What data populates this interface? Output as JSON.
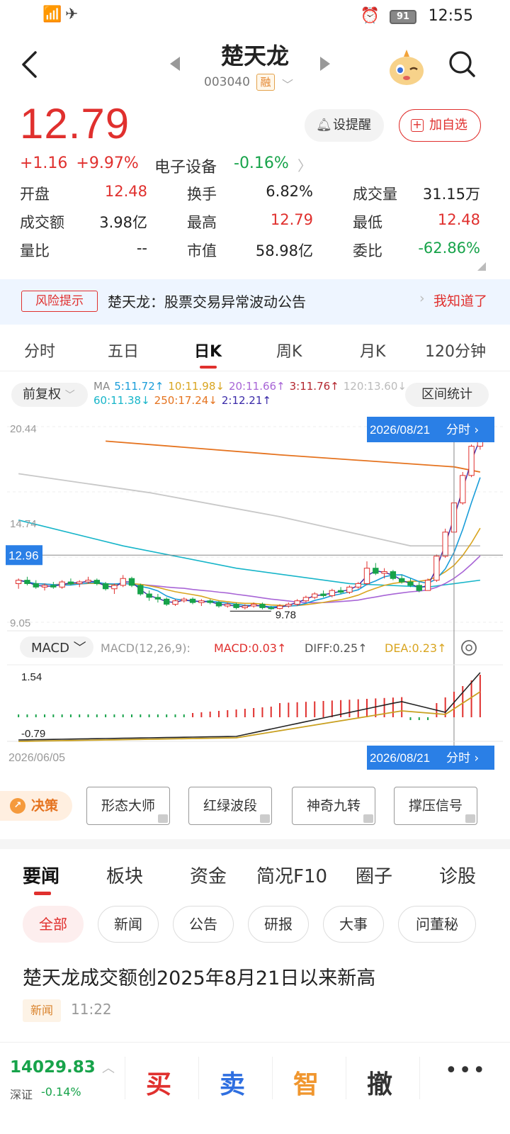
{
  "status_bar": {
    "time": "12:55",
    "battery": "91"
  },
  "header": {
    "title": "楚天龙",
    "code": "003040",
    "margin_tag": "融"
  },
  "quote": {
    "price": "12.79",
    "change": "+1.16",
    "change_pct": "+9.97%",
    "sector_name": "电子设备",
    "sector_change": "-0.16%",
    "alert_label": "设提醒",
    "watch_label": "加自选",
    "stats": [
      {
        "label": "开盘",
        "value": "12.48",
        "color": "#e0302e"
      },
      {
        "label": "换手",
        "value": "6.82%",
        "color": "#222222"
      },
      {
        "label": "成交量",
        "value": "31.15万",
        "color": "#222222"
      },
      {
        "label": "成交额",
        "value": "3.98亿",
        "color": "#222222"
      },
      {
        "label": "最高",
        "value": "12.79",
        "color": "#e0302e"
      },
      {
        "label": "最低",
        "value": "12.48",
        "color": "#e0302e"
      },
      {
        "label": "量比",
        "value": "--",
        "color": "#222222"
      },
      {
        "label": "市值",
        "value": "58.98亿",
        "color": "#222222"
      },
      {
        "label": "委比",
        "value": "-62.86%",
        "color": "#17a34a"
      }
    ]
  },
  "risk": {
    "badge": "风险提示",
    "text": "楚天龙：股票交易异常波动公告",
    "dismiss": "我知道了"
  },
  "period_tabs": [
    "分时",
    "五日",
    "日K",
    "周K",
    "月K",
    "120分钟"
  ],
  "active_period": "日K",
  "ma_bar": {
    "adjust_label": "前复权",
    "range_label": "区间统计",
    "line1": [
      {
        "text": "MA",
        "color": "#888888"
      },
      {
        "text": "5:11.72↑",
        "color": "#1a9dd9"
      },
      {
        "text": "10:11.98↓",
        "color": "#d9a520"
      },
      {
        "text": "20:11.66↑",
        "color": "#a865d6"
      },
      {
        "text": "3:11.76↑",
        "color": "#b3262e"
      },
      {
        "text": "120:13.60↓",
        "color": "#bbbbbb"
      }
    ],
    "line2": [
      {
        "text": "60:11.38↓",
        "color": "#17b5c9"
      },
      {
        "text": "250:17.24↓",
        "color": "#e5731f"
      },
      {
        "text": "2:12.21↑",
        "color": "#3a2aa8"
      }
    ]
  },
  "chart_data": {
    "type": "candlestick",
    "y_labels": [
      "20.44",
      "14.74",
      "9.05"
    ],
    "ylim": [
      9.05,
      20.44
    ],
    "cursor_price": "12.96",
    "low_marker": "9.78",
    "date_start": "2026/06/05",
    "date_cursor": "2026/08/21",
    "cursor_link": "分时",
    "candles": [
      [
        11.3,
        11.6,
        11.0,
        11.5
      ],
      [
        11.5,
        11.7,
        11.2,
        11.3
      ],
      [
        11.3,
        11.5,
        11.0,
        11.1
      ],
      [
        11.1,
        11.3,
        10.9,
        11.2
      ],
      [
        11.2,
        11.4,
        11.0,
        11.1
      ],
      [
        11.1,
        11.5,
        11.0,
        11.4
      ],
      [
        11.4,
        11.6,
        11.2,
        11.3
      ],
      [
        11.3,
        11.5,
        11.1,
        11.4
      ],
      [
        11.4,
        11.7,
        11.3,
        11.5
      ],
      [
        11.5,
        11.6,
        11.2,
        11.3
      ],
      [
        11.3,
        11.4,
        10.9,
        11.0
      ],
      [
        11.0,
        11.3,
        10.7,
        11.2
      ],
      [
        11.2,
        11.8,
        11.1,
        11.6
      ],
      [
        11.6,
        11.7,
        11.1,
        11.2
      ],
      [
        11.2,
        11.3,
        10.6,
        10.7
      ],
      [
        10.7,
        10.9,
        10.3,
        10.5
      ],
      [
        10.5,
        10.7,
        10.2,
        10.4
      ],
      [
        10.4,
        10.5,
        10.0,
        10.1
      ],
      [
        10.1,
        10.4,
        10.0,
        10.3
      ],
      [
        10.3,
        10.5,
        10.2,
        10.4
      ],
      [
        10.4,
        10.5,
        10.1,
        10.2
      ],
      [
        10.2,
        10.4,
        10.0,
        10.3
      ],
      [
        10.3,
        10.4,
        10.1,
        10.2
      ],
      [
        10.2,
        10.3,
        9.9,
        10.0
      ],
      [
        10.0,
        10.2,
        9.9,
        10.1
      ],
      [
        10.1,
        10.2,
        9.8,
        9.9
      ],
      [
        9.9,
        10.1,
        9.8,
        10.0
      ],
      [
        10.0,
        10.2,
        9.9,
        10.1
      ],
      [
        10.1,
        10.2,
        9.8,
        9.9
      ],
      [
        9.9,
        10.0,
        9.78,
        9.85
      ],
      [
        9.85,
        10.1,
        9.8,
        10.0
      ],
      [
        10.0,
        10.2,
        9.9,
        10.1
      ],
      [
        10.1,
        10.4,
        10.0,
        10.3
      ],
      [
        10.3,
        10.6,
        10.2,
        10.5
      ],
      [
        10.5,
        10.8,
        10.4,
        10.7
      ],
      [
        10.7,
        10.9,
        10.5,
        10.6
      ],
      [
        10.6,
        11.0,
        10.5,
        10.9
      ],
      [
        10.9,
        11.1,
        10.7,
        10.8
      ],
      [
        10.8,
        11.2,
        10.7,
        11.1
      ],
      [
        11.1,
        11.4,
        11.0,
        11.3
      ],
      [
        11.3,
        12.6,
        11.2,
        12.2
      ],
      [
        12.2,
        12.5,
        11.8,
        11.9
      ],
      [
        11.9,
        12.2,
        11.6,
        12.0
      ],
      [
        12.0,
        12.1,
        11.5,
        11.6
      ],
      [
        11.6,
        11.8,
        11.3,
        11.4
      ],
      [
        11.4,
        11.6,
        11.1,
        11.2
      ],
      [
        11.2,
        11.4,
        10.8,
        10.9
      ],
      [
        10.9,
        11.6,
        10.9,
        11.5
      ],
      [
        11.5,
        13.0,
        11.4,
        12.9
      ],
      [
        12.9,
        14.5,
        12.8,
        14.3
      ],
      [
        14.3,
        16.2,
        14.2,
        16.0
      ],
      [
        16.0,
        17.8,
        15.9,
        17.6
      ],
      [
        17.6,
        19.4,
        17.5,
        19.3
      ],
      [
        19.3,
        20.44,
        19.1,
        20.2
      ]
    ],
    "macd_label": "MACD",
    "macd_params": "MACD(12,26,9):",
    "macd_value": "MACD:0.03↑",
    "diff_value": "DIFF:0.25↑",
    "dea_value": "DEA:0.23↑",
    "macd_ylabels": [
      "1.54",
      "-0.79"
    ]
  },
  "decision": {
    "label": "决策",
    "tools": [
      "形态大师",
      "红绿波段",
      "神奇九转",
      "撑压信号"
    ]
  },
  "news_tabs": [
    "要闻",
    "板块",
    "资金",
    "简况F10",
    "圈子",
    "诊股"
  ],
  "news_filters": [
    "全部",
    "新闻",
    "公告",
    "研报",
    "大事",
    "问董秘"
  ],
  "news_items": [
    {
      "title": "楚天龙成交额创2025年8月21日以来新高",
      "tag": "新闻",
      "time": "11:22"
    }
  ],
  "bottom_bar": {
    "index_value": "14029.83",
    "index_name": "深证",
    "index_change": "-0.14%",
    "buy": "买",
    "sell": "卖",
    "smart": "智",
    "cancel": "撤"
  }
}
